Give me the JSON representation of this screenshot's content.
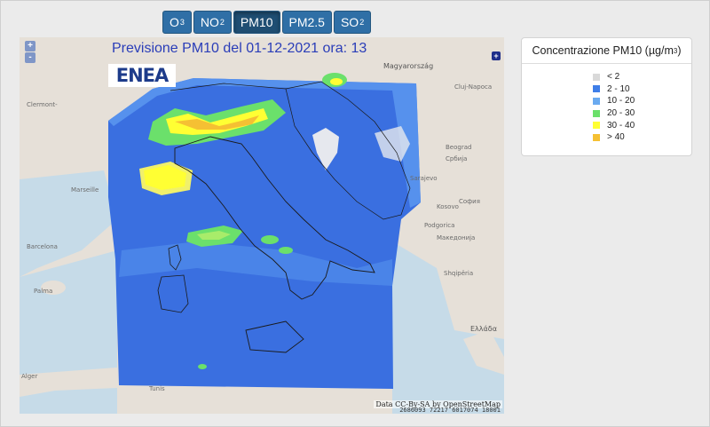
{
  "tabs": [
    {
      "base": "O",
      "sub": "3",
      "active": false
    },
    {
      "base": "NO",
      "sub": "2",
      "active": false
    },
    {
      "base": "PM10",
      "sub": "",
      "active": true
    },
    {
      "base": "PM2.5",
      "sub": "",
      "active": false
    },
    {
      "base": "SO",
      "sub": "2",
      "active": false
    }
  ],
  "map": {
    "title": "Previsione PM10 del 01-12-2021 ora: 13",
    "logo": "ENEA",
    "zoom_in": "+",
    "zoom_out": "-",
    "layer_button": "+",
    "attribution": "Data CC-By-SA by OpenStreetMap",
    "coords": "2686093 72217 6017074 18001",
    "places": [
      {
        "name": "Magyarország",
        "big": true
      },
      {
        "name": "Cluj-Napoca",
        "big": false
      },
      {
        "name": "Beograd",
        "big": false
      },
      {
        "name": "Србија",
        "big": false
      },
      {
        "name": "София",
        "big": false
      },
      {
        "name": "Kosovo",
        "big": false
      },
      {
        "name": "Македонија",
        "big": false
      },
      {
        "name": "Shqipëria",
        "big": false
      },
      {
        "name": "Ελλάδα",
        "big": true
      },
      {
        "name": "Clermont-",
        "big": false
      },
      {
        "name": "Marseille",
        "big": false
      },
      {
        "name": "Barcelona",
        "big": false
      },
      {
        "name": "Palma",
        "big": false
      },
      {
        "name": "Alger",
        "big": false
      },
      {
        "name": "Tunis",
        "big": false
      },
      {
        "name": "Podgorica",
        "big": false
      },
      {
        "name": "Sarajevo",
        "big": false
      }
    ]
  },
  "legend": {
    "title": "Concentrazione PM10 (µg/m",
    "title_sup": "3",
    "title_close": ")",
    "items": [
      {
        "label": "< 2",
        "color": "#d9d9d9"
      },
      {
        "label": "2 - 10",
        "color": "#3f7ee8"
      },
      {
        "label": "10 - 20",
        "color": "#6aaaf0"
      },
      {
        "label": "20 - 30",
        "color": "#6be06b"
      },
      {
        "label": "30 - 40",
        "color": "#ffff33"
      },
      {
        "label": "> 40",
        "color": "#f5c033"
      }
    ]
  }
}
